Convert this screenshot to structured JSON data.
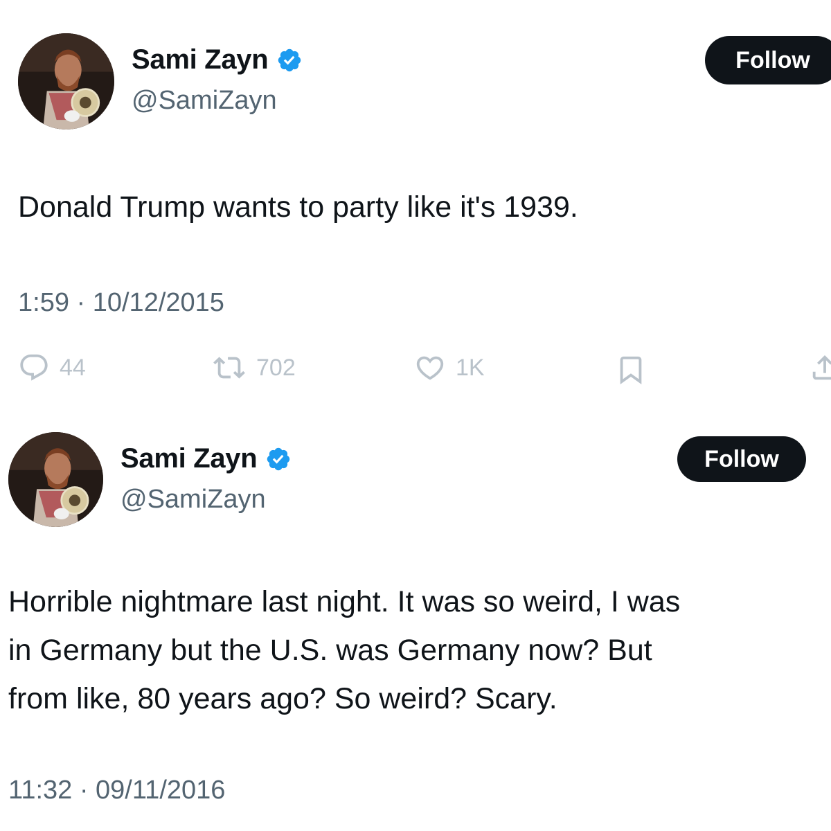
{
  "tweets": [
    {
      "display_name": "Sami Zayn",
      "handle": "@SamiZayn",
      "follow_label": "Follow",
      "text_lines": [
        "Donald Trump wants to party like it's 1939."
      ],
      "timestamp": "1:59 · 10/12/2015",
      "actions": {
        "replies": "44",
        "retweets": "702",
        "likes": "1K"
      }
    },
    {
      "display_name": "Sami Zayn",
      "handle": "@SamiZayn",
      "follow_label": "Follow",
      "text_lines": [
        "Horrible nightmare last night. It was so weird, I was",
        "in Germany but the U.S. was Germany now? But",
        "from like, 80 years ago? So weird? Scary."
      ],
      "timestamp": "11:32 · 09/11/2016"
    }
  ],
  "icons": {
    "verified": "verified-badge-icon",
    "reply": "reply-icon",
    "retweet": "retweet-icon",
    "like": "heart-icon",
    "bookmark": "bookmark-icon",
    "share": "share-icon"
  },
  "colors": {
    "text": "#0f1419",
    "secondary": "#536471",
    "action_gray": "#b9c2ca",
    "verified_blue": "#1d9bf0",
    "button_bg": "#0f1419"
  }
}
